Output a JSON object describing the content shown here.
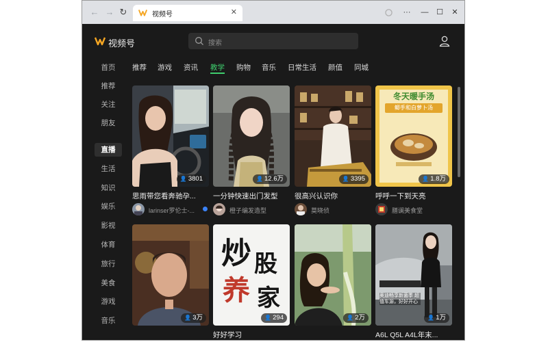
{
  "browser": {
    "tab_title": "视频号",
    "tab_close": "✕",
    "nav": {
      "back": "←",
      "forward": "→",
      "reload": "↻"
    },
    "window_controls": {
      "more": "···",
      "minimize": "—",
      "maximize": "☐",
      "close": "✕"
    }
  },
  "header": {
    "brand": "视频号",
    "search_placeholder": "搜索",
    "icons": [
      "logo-icon",
      "search-icon",
      "user-icon"
    ]
  },
  "sidebar": {
    "items": [
      {
        "label": "首页"
      },
      {
        "label": "推荐"
      },
      {
        "label": "关注"
      },
      {
        "label": "朋友"
      },
      {
        "label": "直播",
        "active": true
      },
      {
        "label": "生活"
      },
      {
        "label": "知识"
      },
      {
        "label": "娱乐"
      },
      {
        "label": "影视"
      },
      {
        "label": "体育"
      },
      {
        "label": "旅行"
      },
      {
        "label": "美食"
      },
      {
        "label": "游戏"
      },
      {
        "label": "音乐"
      }
    ]
  },
  "categories": [
    {
      "label": "推荐"
    },
    {
      "label": "游戏"
    },
    {
      "label": "资讯"
    },
    {
      "label": "教学",
      "active": true
    },
    {
      "label": "购物"
    },
    {
      "label": "音乐"
    },
    {
      "label": "日常生活"
    },
    {
      "label": "颜值"
    },
    {
      "label": "同城"
    }
  ],
  "cards": [
    {
      "title": "思雨带您看奔驰孕...",
      "views": "3801",
      "author": "larinser罗伦士-...",
      "verified": true,
      "scene": "car"
    },
    {
      "title": "一分钟快速出门发型",
      "views": "12.6万",
      "author": "橙子编发造型",
      "scene": "braids"
    },
    {
      "title": "很高兴认识你",
      "views": "3395",
      "author": "莫晓侦",
      "scene": "studio"
    },
    {
      "title": "呼呼一下到天亮",
      "views": "1.8万",
      "author": "膳谰美食堂",
      "scene": "food",
      "poster_title": "冬天暖手汤",
      "poster_subtitle": "鲫手和白萝卜汤"
    },
    {
      "title": "",
      "views": "3万",
      "scene": "man"
    },
    {
      "title": "好好学习",
      "views": "294",
      "scene": "calligraphy",
      "poster_chars": [
        "炒",
        "股",
        "养",
        "家"
      ]
    },
    {
      "title": "",
      "views": "2万",
      "scene": "greenhouse"
    },
    {
      "title": "A6L Q5L A4L年末...",
      "views": "1万",
      "scene": "audi",
      "overlay_text": "奥迪畅享新菌季 超值车源，好好开心"
    }
  ],
  "colors": {
    "background": "#1a1a1a",
    "accent": "#3fcf6e",
    "logo": "#f5a623",
    "text": "#ededed",
    "muted": "#9a9a9a"
  }
}
